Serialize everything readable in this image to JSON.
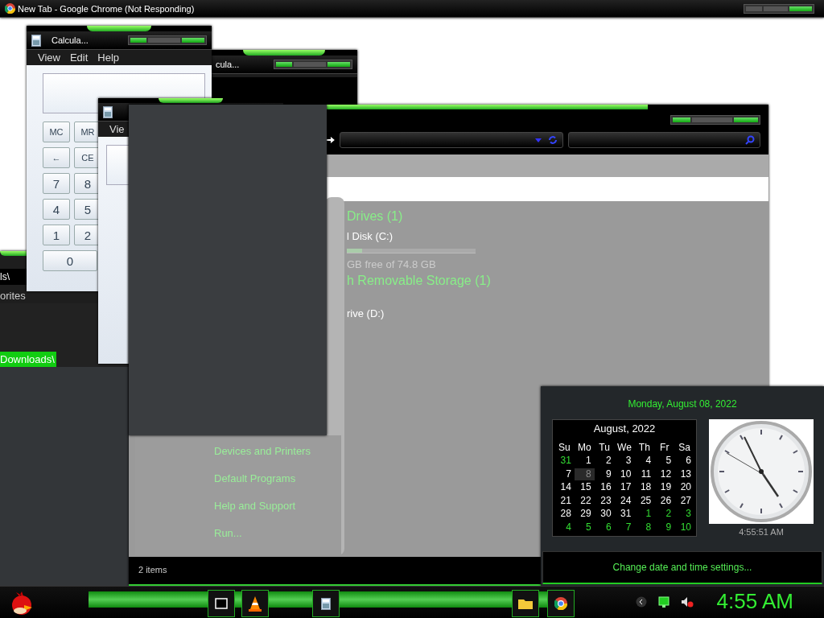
{
  "chrome": {
    "title": "New Tab - Google Chrome (Not Responding)"
  },
  "calculator_back": {
    "title": "cula..."
  },
  "calculator_front": {
    "title": "Calcula...",
    "menu": [
      "View",
      "Edit",
      "Help"
    ],
    "keys": [
      "MC",
      "MR",
      "←",
      "CE",
      "7",
      "8",
      "4",
      "5",
      "1",
      "2",
      "0"
    ]
  },
  "folder_window": {
    "address": "ls\\",
    "nav_items": [
      {
        "label": "orites",
        "selected": false
      },
      {
        "label": "Downloads\\",
        "selected": true
      }
    ]
  },
  "calculator_middle": {
    "menu": [
      "Vie"
    ]
  },
  "explorer": {
    "groups": [
      {
        "heading": "Drives (1)",
        "items": [
          {
            "kind": "disk",
            "name": "l Disk (C:)",
            "level": 0.12,
            "free": "GB free of 74.8 GB"
          }
        ]
      },
      {
        "heading": "h Removable Storage (1)",
        "items": [
          {
            "kind": "plain",
            "name": "rive (D:)"
          }
        ]
      }
    ],
    "status": "2 items"
  },
  "start_menu": {
    "links": [
      "Devices and Printers",
      "Default Programs",
      "Help and Support",
      "Run..."
    ]
  },
  "calendar": {
    "date": "Monday, August 08, 2022",
    "month": "August, 2022",
    "weekdays": [
      "Su",
      "Mo",
      "Tu",
      "We",
      "Th",
      "Fr",
      "Sa"
    ],
    "weeks": [
      [
        {
          "day": "31",
          "kind": "other",
          "selected": false
        },
        {
          "day": "1",
          "kind": "current",
          "selected": false
        },
        {
          "day": "2",
          "kind": "current",
          "selected": false
        },
        {
          "day": "3",
          "kind": "current",
          "selected": false
        },
        {
          "day": "4",
          "kind": "current",
          "selected": false
        },
        {
          "day": "5",
          "kind": "current",
          "selected": false
        },
        {
          "day": "6",
          "kind": "current",
          "selected": false
        }
      ],
      [
        {
          "day": "7",
          "kind": "current",
          "selected": false
        },
        {
          "day": "8",
          "kind": "current",
          "selected": true
        },
        {
          "day": "9",
          "kind": "current",
          "selected": false
        },
        {
          "day": "10",
          "kind": "current",
          "selected": false
        },
        {
          "day": "11",
          "kind": "current",
          "selected": false
        },
        {
          "day": "12",
          "kind": "current",
          "selected": false
        },
        {
          "day": "13",
          "kind": "current",
          "selected": false
        }
      ],
      [
        {
          "day": "14",
          "kind": "current",
          "selected": false
        },
        {
          "day": "15",
          "kind": "current",
          "selected": false
        },
        {
          "day": "16",
          "kind": "current",
          "selected": false
        },
        {
          "day": "17",
          "kind": "current",
          "selected": false
        },
        {
          "day": "18",
          "kind": "current",
          "selected": false
        },
        {
          "day": "19",
          "kind": "current",
          "selected": false
        },
        {
          "day": "20",
          "kind": "current",
          "selected": false
        }
      ],
      [
        {
          "day": "21",
          "kind": "current",
          "selected": false
        },
        {
          "day": "22",
          "kind": "current",
          "selected": false
        },
        {
          "day": "23",
          "kind": "current",
          "selected": false
        },
        {
          "day": "24",
          "kind": "current",
          "selected": false
        },
        {
          "day": "25",
          "kind": "current",
          "selected": false
        },
        {
          "day": "26",
          "kind": "current",
          "selected": false
        },
        {
          "day": "27",
          "kind": "current",
          "selected": false
        }
      ],
      [
        {
          "day": "28",
          "kind": "current",
          "selected": false
        },
        {
          "day": "29",
          "kind": "current",
          "selected": false
        },
        {
          "day": "30",
          "kind": "current",
          "selected": false
        },
        {
          "day": "31",
          "kind": "current",
          "selected": false
        },
        {
          "day": "1",
          "kind": "other",
          "selected": false
        },
        {
          "day": "2",
          "kind": "other",
          "selected": false
        },
        {
          "day": "3",
          "kind": "other",
          "selected": false
        }
      ],
      [
        {
          "day": "4",
          "kind": "other",
          "selected": false
        },
        {
          "day": "5",
          "kind": "other",
          "selected": false
        },
        {
          "day": "6",
          "kind": "other",
          "selected": false
        },
        {
          "day": "7",
          "kind": "other",
          "selected": false
        },
        {
          "day": "8",
          "kind": "other",
          "selected": false
        },
        {
          "day": "9",
          "kind": "other",
          "selected": false
        },
        {
          "day": "10",
          "kind": "other",
          "selected": false
        }
      ]
    ],
    "time": "4:55:51 AM",
    "link": "Change date and time settings..."
  },
  "taskbar": {
    "clock": "4:55 AM"
  }
}
